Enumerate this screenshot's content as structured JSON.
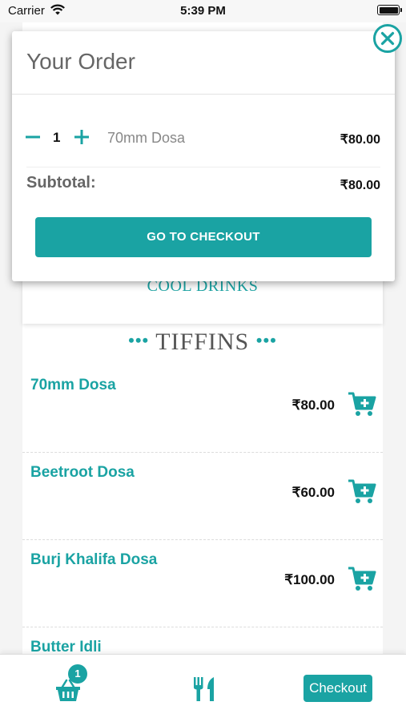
{
  "status_bar": {
    "carrier": "Carrier",
    "time": "5:39 PM"
  },
  "menu": {
    "category_label": "COOL DRINKS",
    "section_title": "TIFFINS",
    "section_dots": "•••",
    "items": [
      {
        "name": "70mm Dosa",
        "price": "₹80.00",
        "cart_icon": "add-to-cart-icon"
      },
      {
        "name": "Beetroot Dosa",
        "price": "₹60.00",
        "cart_icon": "add-to-cart-icon"
      },
      {
        "name": "Burj Khalifa Dosa",
        "price": "₹100.00",
        "cart_icon": "add-to-cart-icon"
      },
      {
        "name": "Butter Idli",
        "price": "",
        "cart_icon": "add-to-cart-icon"
      }
    ]
  },
  "order_popup": {
    "title": "Your Order",
    "line_item": {
      "quantity": "1",
      "name": "70mm Dosa",
      "price": "₹80.00"
    },
    "subtotal_label": "Subtotal:",
    "subtotal_value": "₹80.00",
    "checkout_button": "GO TO CHECKOUT",
    "close_icon": "close-icon"
  },
  "tab_bar": {
    "basket_icon": "basket-icon",
    "basket_badge": "1",
    "food_icon": "fork-knife-icon",
    "checkout_label": "Checkout"
  },
  "colors": {
    "accent": "#1aa3a3",
    "text_dark": "#111111",
    "text_muted": "#666666"
  }
}
